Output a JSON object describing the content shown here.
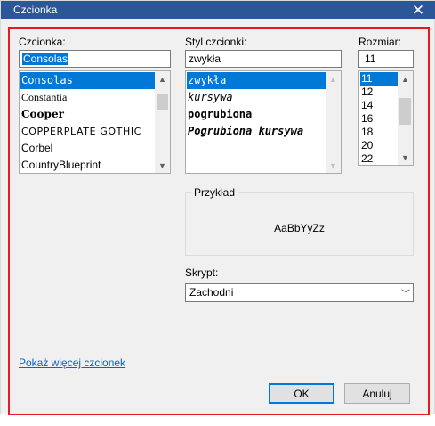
{
  "window": {
    "title": "Czcionka",
    "close_glyph": "✕"
  },
  "font": {
    "label": "Czcionka:",
    "value": "Consolas",
    "items": [
      {
        "text": "Consolas",
        "selected": true
      },
      {
        "text": "Constantia",
        "selected": false
      },
      {
        "text": "Cooper",
        "selected": false
      },
      {
        "text": "COPPERPLATE GOTHIC",
        "selected": false
      },
      {
        "text": "Corbel",
        "selected": false
      },
      {
        "text": "CountryBlueprint",
        "selected": false
      }
    ]
  },
  "style": {
    "label": "Styl czcionki:",
    "value": "zwykła",
    "items": [
      {
        "text": "zwykła",
        "selected": true
      },
      {
        "text": "kursywa",
        "selected": false
      },
      {
        "text": "pogrubiona",
        "selected": false
      },
      {
        "text": "Pogrubiona kursywa",
        "selected": false
      }
    ]
  },
  "size": {
    "label": "Rozmiar:",
    "value": "11",
    "items": [
      {
        "text": "11",
        "selected": true
      },
      {
        "text": "12",
        "selected": false
      },
      {
        "text": "14",
        "selected": false
      },
      {
        "text": "16",
        "selected": false
      },
      {
        "text": "18",
        "selected": false
      },
      {
        "text": "20",
        "selected": false
      },
      {
        "text": "22",
        "selected": false
      }
    ]
  },
  "sample": {
    "label": "Przykład",
    "text": "AaBbYyZz"
  },
  "script": {
    "label": "Skrypt:",
    "value": "Zachodni"
  },
  "more_fonts_link": "Pokaż więcej czcionek",
  "buttons": {
    "ok": "OK",
    "cancel": "Anuluj"
  },
  "colors": {
    "titlebar": "#2b5797",
    "selection": "#0078d7",
    "focus_frame": "#e31b23",
    "link": "#0066cc"
  },
  "icons": {
    "close": "close-icon",
    "scroll_up": "chevron-up-icon",
    "scroll_down": "chevron-down-icon",
    "combo": "chevron-down-icon"
  }
}
